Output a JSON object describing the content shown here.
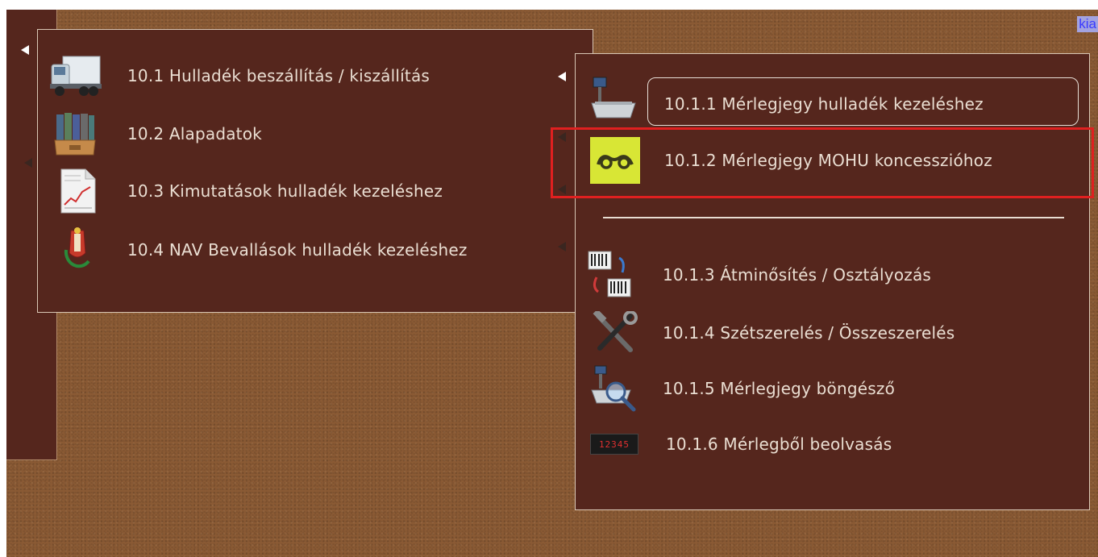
{
  "corner_link": {
    "label": "kia"
  },
  "main_menu": {
    "items": [
      {
        "label": "10.1 Hulladék beszállítás / kiszállítás",
        "icon": "truck-icon"
      },
      {
        "label": "10.2 Alapadatok",
        "icon": "binders-icon"
      },
      {
        "label": "10.3 Kimutatások hulladék kezeléshez",
        "icon": "report-chart-icon"
      },
      {
        "label": "10.4 NAV Bevallások hulladék kezeléshez",
        "icon": "nav-emblem-icon"
      }
    ]
  },
  "sub_menu": {
    "items": [
      {
        "label": "10.1.1 Mérlegjegy hulladék kezeléshez",
        "icon": "scale-icon"
      },
      {
        "label": "10.1.2 Mérlegjegy MOHU koncesszióhoz",
        "icon": "mohu-logo-icon"
      },
      {
        "label": "10.1.3 Átminősítés / Osztályozás",
        "icon": "barcode-swap-icon"
      },
      {
        "label": "10.1.4 Szétszerelés / Összeszerelés",
        "icon": "tools-icon"
      },
      {
        "label": "10.1.5 Mérlegjegy böngésző",
        "icon": "scale-search-icon"
      },
      {
        "label": "10.1.6 Mérlegből beolvasás",
        "icon": "digital-display-icon"
      }
    ],
    "display_digits": "12345"
  },
  "colors": {
    "panel_bg": "#55261d",
    "text": "#eaded2",
    "highlight": "#e02020",
    "mohu_yellow": "#d8e635"
  }
}
